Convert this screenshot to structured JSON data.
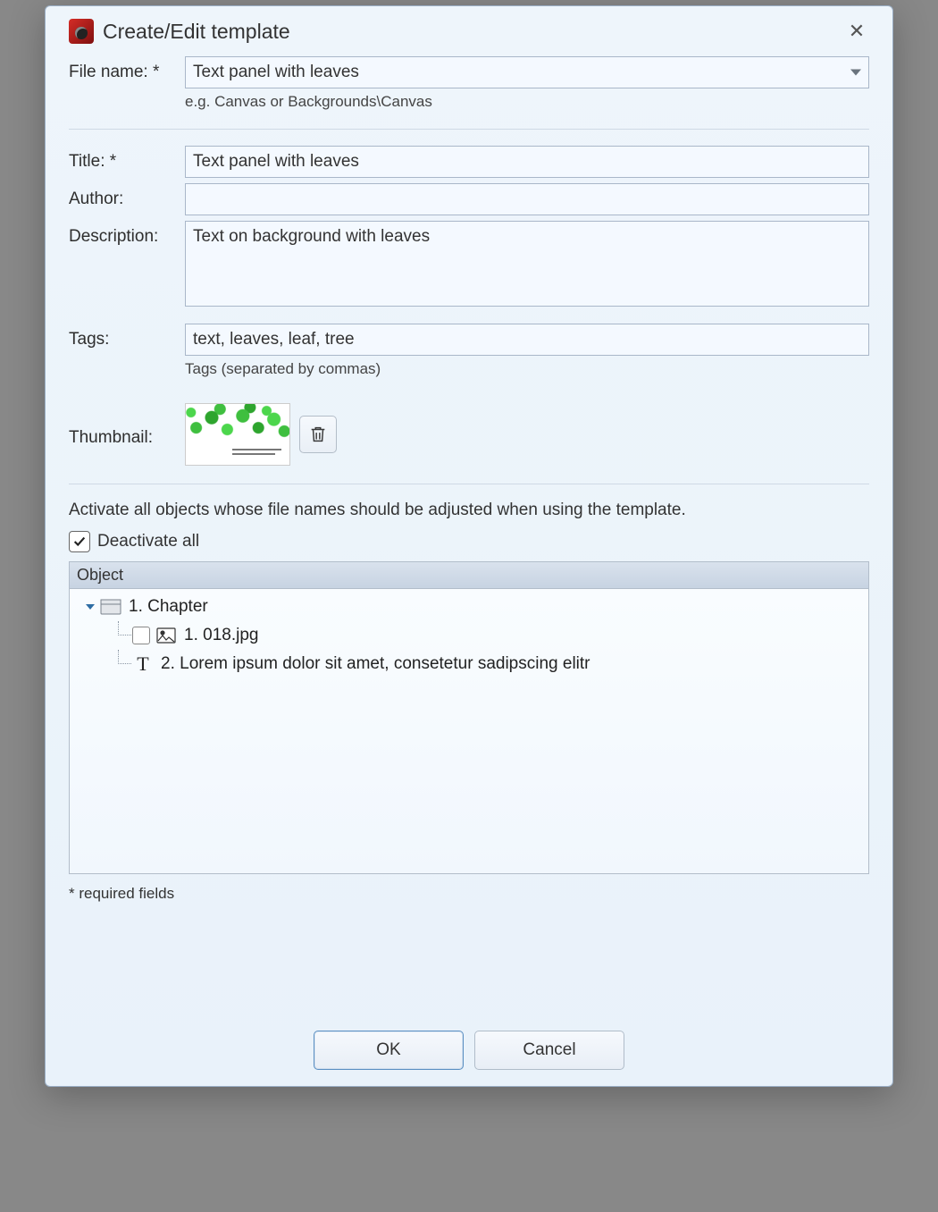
{
  "window": {
    "title": "Create/Edit template"
  },
  "fields": {
    "file_name": {
      "label": "File name: *",
      "value": "Text panel with leaves",
      "hint": "e.g. Canvas or Backgrounds\\Canvas"
    },
    "title": {
      "label": "Title: *",
      "value": "Text panel with leaves"
    },
    "author": {
      "label": "Author:",
      "value": ""
    },
    "description": {
      "label": "Description:",
      "value": "Text on background with leaves"
    },
    "tags": {
      "label": "Tags:",
      "value": "text, leaves, leaf, tree",
      "hint": "Tags (separated by commas)"
    },
    "thumbnail": {
      "label": "Thumbnail:"
    }
  },
  "instruction": "Activate all objects whose file names should be adjusted when using the template.",
  "deactivate_all": {
    "label": "Deactivate all",
    "checked": true
  },
  "object_tree": {
    "header": "Object",
    "nodes": [
      {
        "level": 0,
        "kind": "chapter",
        "label": "1. Chapter",
        "expanded": true
      },
      {
        "level": 1,
        "kind": "image",
        "label": "1. 018.jpg",
        "has_checkbox": true,
        "checked": false
      },
      {
        "level": 1,
        "kind": "text",
        "label": "2. Lorem ipsum dolor sit amet, consetetur sadipscing elitr",
        "has_checkbox": false
      }
    ]
  },
  "required_note": "* required fields",
  "buttons": {
    "ok": "OK",
    "cancel": "Cancel"
  }
}
